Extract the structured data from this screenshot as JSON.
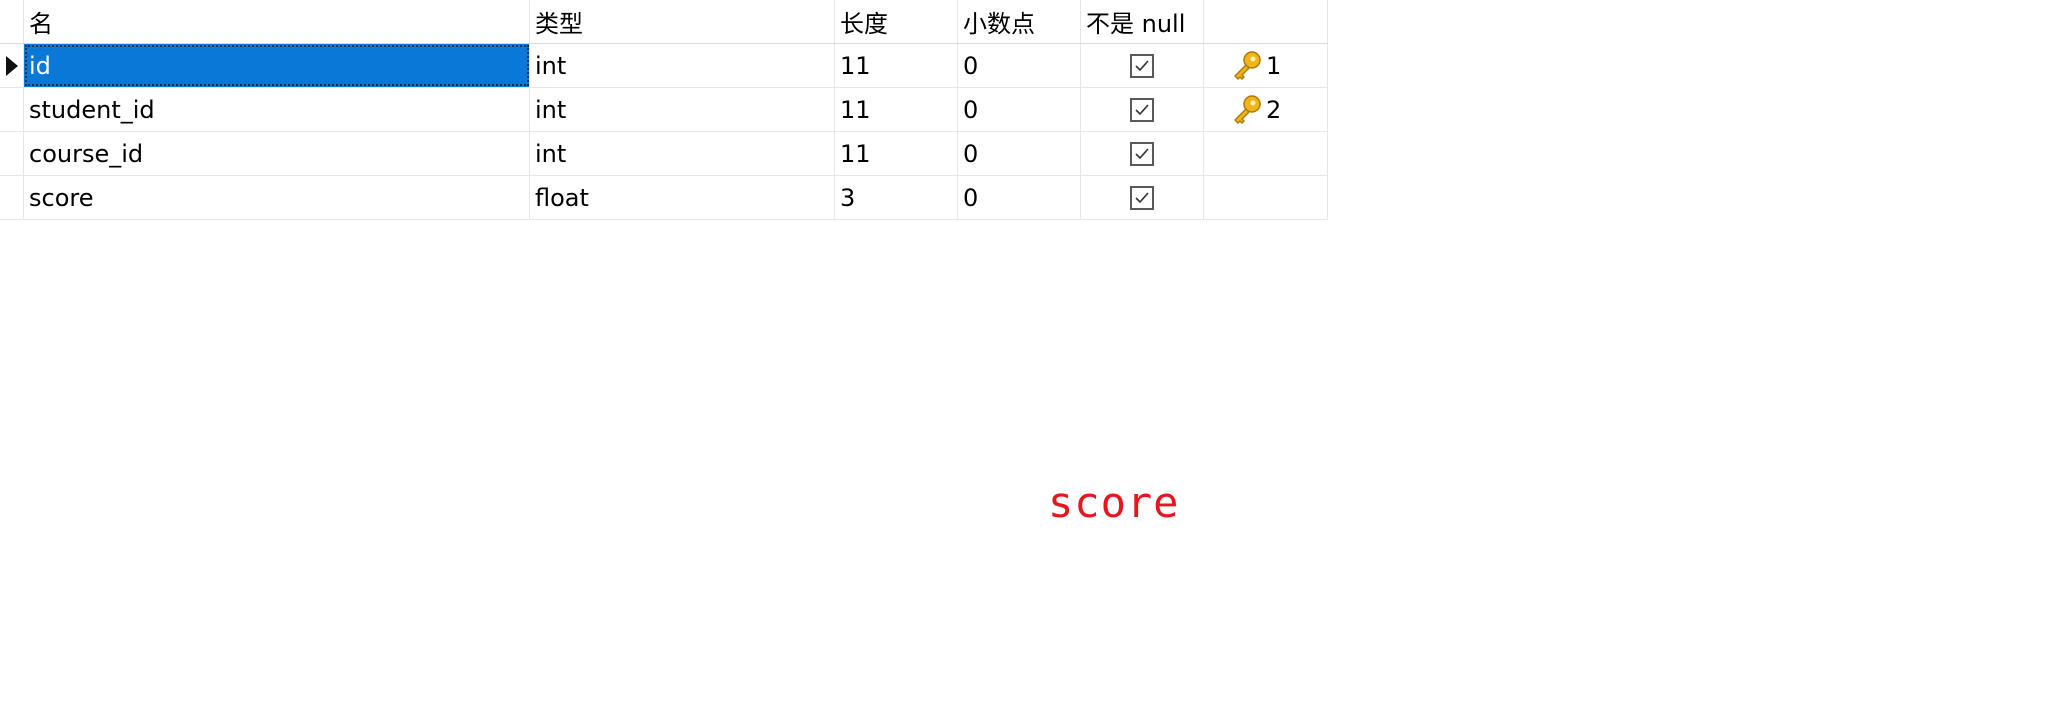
{
  "table": {
    "headers": {
      "name": "名",
      "type": "类型",
      "length": "长度",
      "decimals": "小数点",
      "not_null": "不是 null",
      "key": ""
    },
    "rows": [
      {
        "name": "id",
        "type": "int",
        "length": "11",
        "decimals": "0",
        "not_null": true,
        "key": "1",
        "selected": true
      },
      {
        "name": "student_id",
        "type": "int",
        "length": "11",
        "decimals": "0",
        "not_null": true,
        "key": "2",
        "selected": false
      },
      {
        "name": "course_id",
        "type": "int",
        "length": "11",
        "decimals": "0",
        "not_null": true,
        "key": "",
        "selected": false
      },
      {
        "name": "score",
        "type": "float",
        "length": "3",
        "decimals": "0",
        "not_null": true,
        "key": "",
        "selected": false
      }
    ]
  },
  "caption": {
    "text": "score"
  },
  "icons": {
    "row_indicator": "row-pointer-icon",
    "checkbox": "checkbox-checked-icon",
    "primary_key": "key-icon"
  },
  "colors": {
    "selection": "#0a78d7",
    "caption": "#e8141e",
    "key": "#f0b51d"
  }
}
